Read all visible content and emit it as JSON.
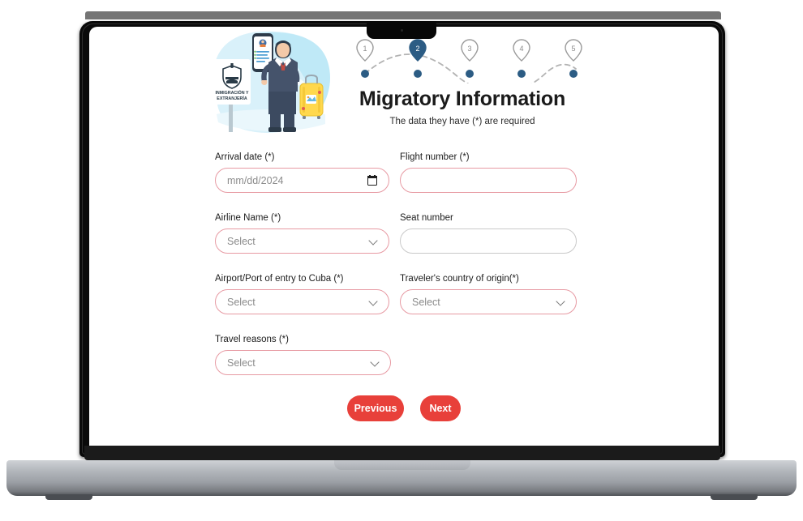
{
  "device": {
    "type": "laptop-mockup",
    "notch_icon": "camera-dot"
  },
  "page": {
    "title": "Migratory Information",
    "subtitle": "The data they have (*) are required",
    "accent_color": "#e8403a",
    "required_border_color": "#e79aa3",
    "optional_border_color": "#c9c9c9",
    "stepper_active_color": "#2c5c84",
    "stepper_inactive_color": "#9a9a9a"
  },
  "illustration": {
    "name": "immigration-officer-illustration",
    "sign_line1": "INMIGRACIÓN Y",
    "sign_line2": "EXTRANJERÍA",
    "objects": [
      "shield-emblem",
      "smartphone",
      "traveler-person",
      "yellow-suitcase",
      "control-tower"
    ]
  },
  "stepper": {
    "current_step": 2,
    "steps": [
      {
        "number": "1",
        "state": "inactive"
      },
      {
        "number": "2",
        "state": "active"
      },
      {
        "number": "3",
        "state": "inactive"
      },
      {
        "number": "4",
        "state": "inactive"
      },
      {
        "number": "5",
        "state": "inactive"
      }
    ]
  },
  "form": {
    "fields": [
      {
        "key": "arrival_date",
        "label": "Arrival date (*)",
        "control": "date",
        "placeholder": "mm/dd/2024",
        "value": "",
        "required": true,
        "icon": "calendar-icon"
      },
      {
        "key": "flight_number",
        "label": "Flight number (*)",
        "control": "text",
        "placeholder": "",
        "value": "",
        "required": true
      },
      {
        "key": "airline_name",
        "label": "Airline Name (*)",
        "control": "select",
        "placeholder": "Select",
        "value": "Select",
        "required": true,
        "icon": "chevron-down-icon"
      },
      {
        "key": "seat_number",
        "label": "Seat number",
        "control": "text",
        "placeholder": "",
        "value": "",
        "required": false
      },
      {
        "key": "airport_entry",
        "label": "Airport/Port of entry to Cuba (*)",
        "control": "select",
        "placeholder": "Select",
        "value": "Select",
        "required": true,
        "icon": "chevron-down-icon"
      },
      {
        "key": "country_origin",
        "label": "Traveler's country of origin(*)",
        "control": "select",
        "placeholder": "Select",
        "value": "Select",
        "required": true,
        "icon": "chevron-down-icon"
      },
      {
        "key": "travel_reasons",
        "label": "Travel reasons (*)",
        "control": "select",
        "placeholder": "Select",
        "value": "Select",
        "required": true,
        "icon": "chevron-down-icon"
      }
    ]
  },
  "buttons": {
    "previous": "Previous",
    "next": "Next"
  }
}
